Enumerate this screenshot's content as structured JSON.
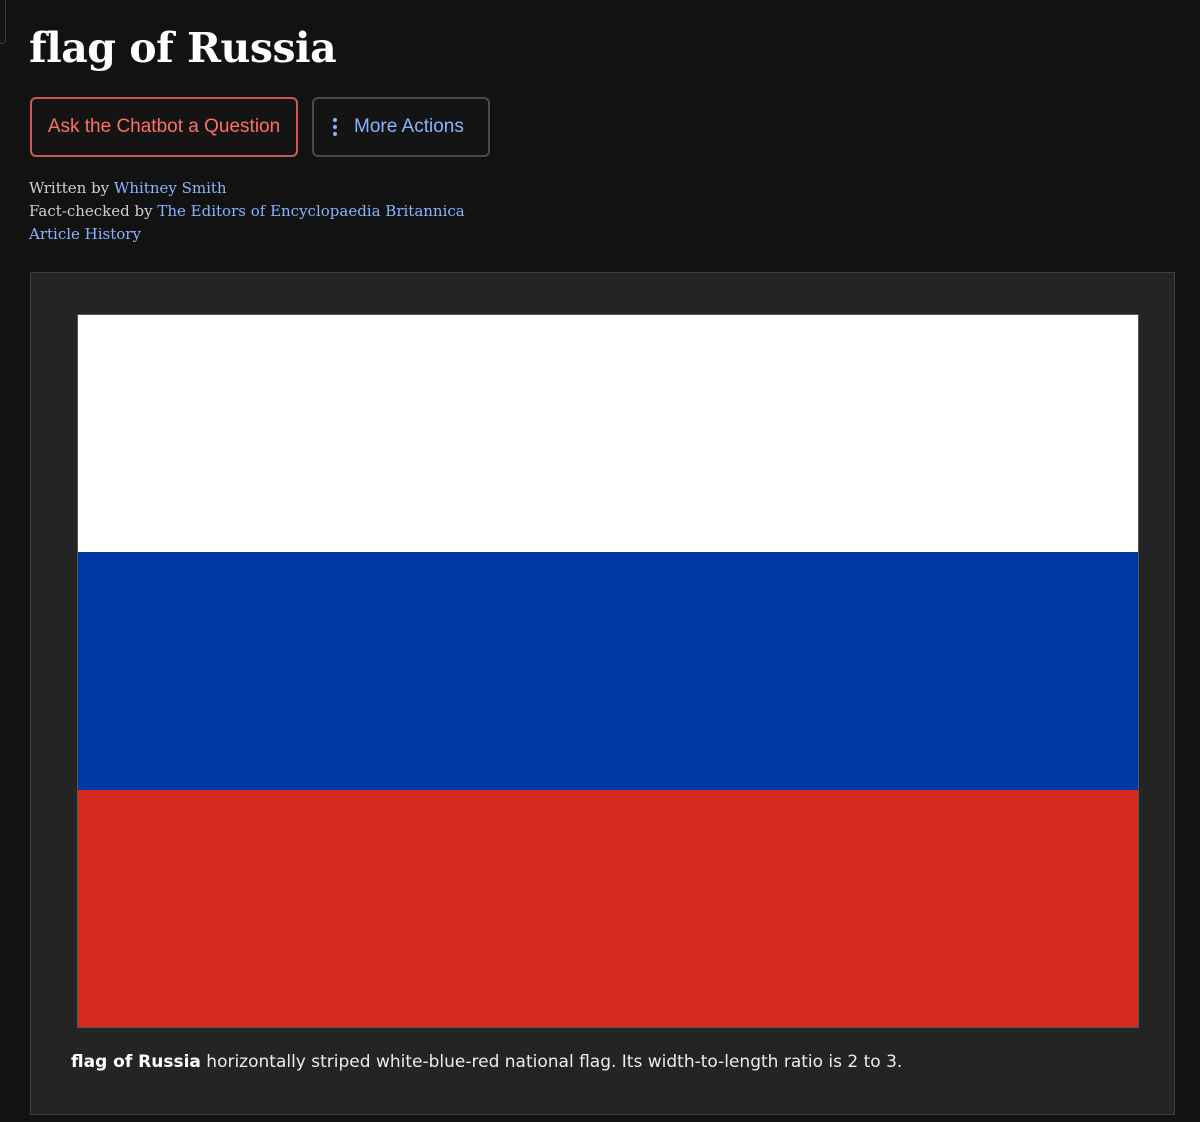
{
  "article": {
    "title": "flag of Russia"
  },
  "actions": {
    "chatbot_label": "Ask the Chatbot a Question",
    "more_label": "More Actions",
    "more_icon": "vertical-dots-icon"
  },
  "byline": {
    "written_prefix": "Written by ",
    "author": "Whitney Smith",
    "factcheck_prefix": "Fact-checked by ",
    "factchecker": "The Editors of Encyclopaedia Britannica",
    "history_link": "Article History"
  },
  "figure": {
    "stripes": [
      {
        "name": "white",
        "color": "#ffffff"
      },
      {
        "name": "blue",
        "color": "#0039a6"
      },
      {
        "name": "red",
        "color": "#d52b1e"
      }
    ],
    "caption_bold": "flag of Russia",
    "caption_text": " horizontally striped white-blue-red national flag. Its width-to-length ratio is 2 to 3."
  },
  "colors": {
    "background": "#121212",
    "link": "#8ab4ff",
    "chatbot_accent": "#ff6f66",
    "figure_bg": "#242424"
  }
}
